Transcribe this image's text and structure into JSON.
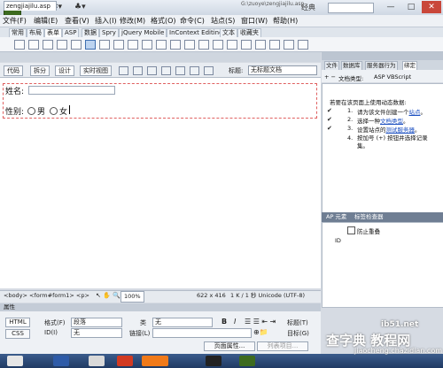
{
  "app": {
    "logo": "Dw",
    "layout": "经典",
    "window_min": "—",
    "window_max": "□",
    "window_close": "✕"
  },
  "menu": [
    "文件(F)",
    "编辑(E)",
    "查看(V)",
    "插入(I)",
    "修改(M)",
    "格式(O)",
    "命令(C)",
    "站点(S)",
    "窗口(W)",
    "帮助(H)"
  ],
  "insert_tabs": [
    "常用",
    "布局",
    "表单",
    "ASP",
    "数据",
    "Spry",
    "jQuery Mobile",
    "InContext Editing",
    "文本",
    "收藏夹"
  ],
  "document": {
    "tab_name": "zengjiajilu.asp",
    "path": "G:\\zuoye\\zengjiajilu.asp",
    "views": [
      "代码",
      "拆分",
      "设计",
      "实时视图"
    ],
    "title_label": "标题:",
    "title_value": "无标题文档"
  },
  "form": {
    "name_label": "姓名:",
    "gender_label": "性别:",
    "option_male": "男",
    "option_female": "女"
  },
  "right_panel": {
    "tabs": [
      "文件",
      "数据库",
      "服务器行为",
      "绑定"
    ],
    "doctype_label": "文档类型:",
    "doctype_value": "ASP VBScript",
    "intro": "若要在该页面上使用动态数据:",
    "steps": [
      {
        "num": "1.",
        "text": "请为该文件创建一个",
        "link": "站点",
        "end": "。"
      },
      {
        "num": "2.",
        "text": "选择一种",
        "link": "文档类型",
        "end": "。"
      },
      {
        "num": "3.",
        "text": "设置站点的",
        "link": "测试服务器",
        "end": "。"
      },
      {
        "num": "4.",
        "text": "按加号 (+) 按钮并选择记录集。",
        "link": "",
        "end": ""
      }
    ],
    "ap_tabs": [
      "AP 元素",
      "标签检查器"
    ],
    "ap_prevent_overlap": "防止重叠",
    "ap_col_id": "ID"
  },
  "status": {
    "tag_path": "<body> <form#form1> <p>",
    "zoom": "100%",
    "size": "622 x 416",
    "info": "1 K / 1 秒 Unicode (UTF-8)"
  },
  "properties": {
    "title": "属性",
    "html_btn": "HTML",
    "css_btn": "CSS",
    "format_label": "格式(F)",
    "format_value": "段落",
    "class_label": "类",
    "class_value": "无",
    "id_label": "ID(I)",
    "id_value": "无",
    "link_label": "链接(L)",
    "title_label": "标题(T)",
    "target_label": "目标(G)",
    "page_props": "页面属性...",
    "list_item": "列表项目..."
  },
  "watermark": {
    "line1": "查字典 教程网",
    "line2": "jiaocheng.chazidian.com",
    "brand": "ib51.net"
  }
}
